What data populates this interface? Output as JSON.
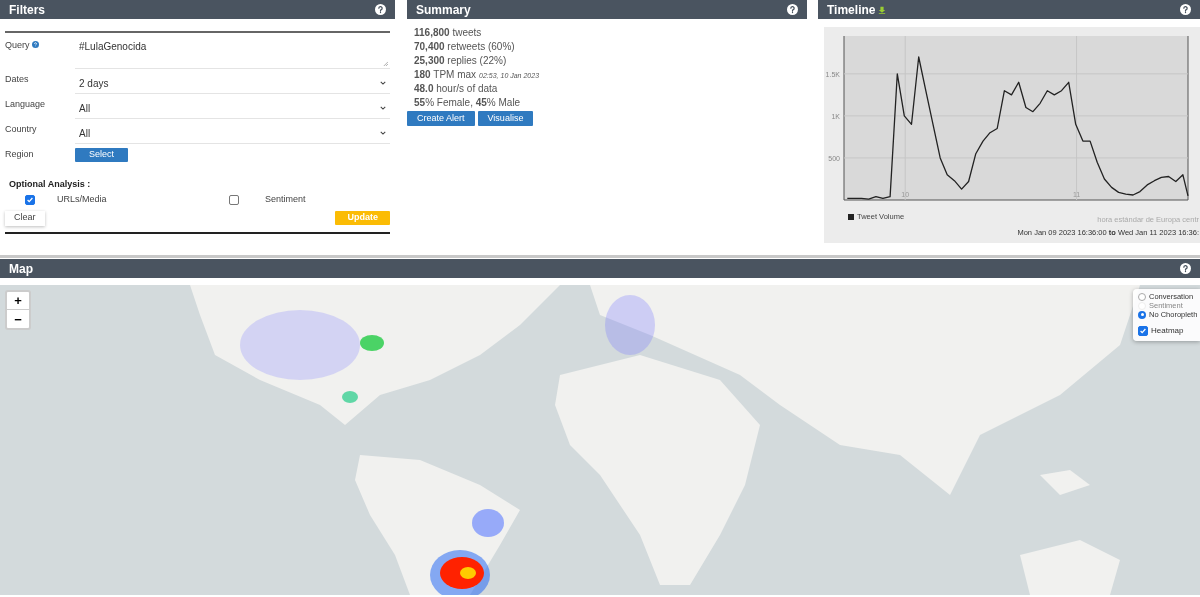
{
  "filters": {
    "title": "Filters",
    "query": {
      "label": "Query",
      "value": "#LulaGenocida"
    },
    "selects": [
      {
        "label": "Dates",
        "value": "2 days"
      },
      {
        "label": "Language",
        "value": "All"
      },
      {
        "label": "Country",
        "value": "All"
      }
    ],
    "region": {
      "label": "Region",
      "button": "Select"
    },
    "optional_analysis": {
      "title": "Optional Analysis :",
      "options": [
        {
          "label": "URLs/Media",
          "checked": true
        },
        {
          "label": "Sentiment",
          "checked": false
        }
      ]
    },
    "clear_button": "Clear",
    "update_button": "Update"
  },
  "summary": {
    "title": "Summary",
    "lines": [
      {
        "text": "**116,800** tweets"
      },
      {
        "text": "**70,400** retweets (60%)"
      },
      {
        "text": "**25,300** replies (22%)"
      },
      {
        "text": "**180** TPM max",
        "note": "02:53, 10 Jan 2023"
      },
      {
        "text": "**48.0** hour/s of data"
      },
      {
        "text": "**55**% Female, **45**% Male"
      }
    ],
    "buttons": [
      "Create Alert",
      "Visualise"
    ]
  },
  "timeline": {
    "title": "Timeline",
    "timezone": "hora estándar de Europa centr",
    "range": "Mon Jan 09 2023 16:36:00 **to** Wed Jan 11 2023 16:36:",
    "chart_data": {
      "type": "line",
      "grid": true,
      "xlim": [
        9.643,
        11.65
      ],
      "ylim": [
        0,
        1950
      ],
      "xticks": [
        10,
        11
      ],
      "yticks": [
        {
          "value": 500,
          "label": "500"
        },
        {
          "value": 1000,
          "label": "1K"
        },
        {
          "value": 1500,
          "label": "1.5K"
        }
      ],
      "x": [
        9.662,
        9.704,
        9.745,
        9.787,
        9.829,
        9.87,
        9.912,
        9.954,
        9.995,
        10.037,
        10.079,
        10.12,
        10.162,
        10.204,
        10.245,
        10.287,
        10.329,
        10.37,
        10.412,
        10.454,
        10.495,
        10.537,
        10.579,
        10.62,
        10.662,
        10.704,
        10.745,
        10.787,
        10.829,
        10.87,
        10.912,
        10.954,
        10.995,
        11.037,
        11.079,
        11.12,
        11.162,
        11.204,
        11.245,
        11.287,
        11.329,
        11.37,
        11.412,
        11.454,
        11.495,
        11.537,
        11.579,
        11.62,
        11.65
      ],
      "series": [
        {
          "name": "Tweet Volume",
          "color": "#222222",
          "values": [
            20,
            20,
            20,
            10,
            40,
            20,
            40,
            1500,
            1000,
            900,
            1700,
            1300,
            900,
            500,
            300,
            230,
            130,
            220,
            550,
            700,
            800,
            850,
            1300,
            1250,
            1400,
            1100,
            1050,
            1150,
            1300,
            1250,
            1300,
            1400,
            900,
            700,
            700,
            450,
            250,
            150,
            90,
            70,
            60,
            100,
            180,
            230,
            270,
            280,
            220,
            300,
            50
          ]
        }
      ]
    }
  },
  "map": {
    "title": "Map",
    "zoom_in": "+",
    "zoom_out": "−",
    "layers": [
      {
        "label": "Conversation",
        "selected": false,
        "disabled": false
      },
      {
        "label": "Sentiment",
        "selected": false,
        "disabled": true
      },
      {
        "label": "No Choropleth",
        "selected": true,
        "disabled": false
      }
    ],
    "heatmap": {
      "label": "Heatmap",
      "checked": true
    }
  }
}
